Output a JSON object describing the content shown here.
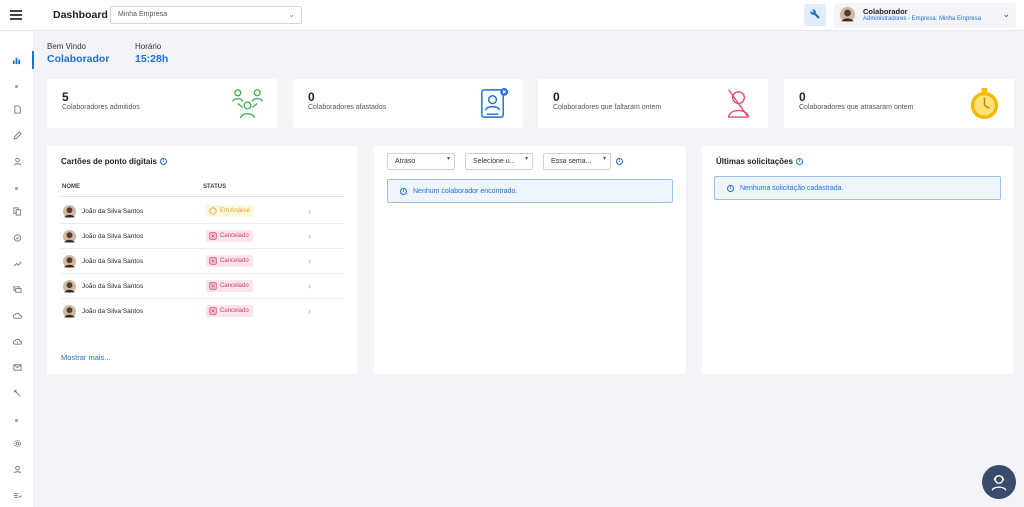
{
  "header": {
    "title": "Dashboard",
    "company": "Minha Empresa",
    "user_name": "Colaborador",
    "user_role": "Administradores - Empresa: Minha Empresa"
  },
  "sidebar": {
    "icons": [
      "chart-bar-icon",
      "file-icon",
      "pencil-icon",
      "user-icon",
      "copy-icon",
      "clock-check-icon",
      "trend-icon",
      "chat-icon",
      "cloud-upload-icon",
      "cloud-download-icon",
      "mail-icon",
      "wrench-icon",
      "gear-icon",
      "user-alt-icon",
      "list-icon"
    ]
  },
  "welcome": {
    "greeting_label": "Bem Vindo",
    "greeting_value": "Colaborador",
    "time_label": "Horário",
    "time_value": "15:28h"
  },
  "stats": [
    {
      "value": "5",
      "label": "Colaboradores admitidos",
      "icon": "people-network-icon",
      "color": "#2fb34a"
    },
    {
      "value": "0",
      "label": "Colaboradores afastados",
      "icon": "id-card-icon",
      "color": "#1e6fd9"
    },
    {
      "value": "0",
      "label": "Colaboradores que faltaram ontem",
      "icon": "absent-user-icon",
      "color": "#e84a6a"
    },
    {
      "value": "0",
      "label": "Colaboradores que atrasaram ontem",
      "icon": "stopwatch-icon",
      "color": "#f5b800"
    }
  ],
  "timecards": {
    "title": "Cartões de ponto digitais",
    "col_name": "NOME",
    "col_status": "STATUS",
    "rows": [
      {
        "name": "João da Silva Santos",
        "status": "Em Análise",
        "kind": "analise"
      },
      {
        "name": "João da Silva Santos",
        "status": "Cancelado",
        "kind": "cancel"
      },
      {
        "name": "João da Silva Santos",
        "status": "Cancelado",
        "kind": "cancel"
      },
      {
        "name": "João da Silva Santos",
        "status": "Cancelado",
        "kind": "cancel"
      },
      {
        "name": "João da Silva Santos",
        "status": "Cancelado",
        "kind": "cancel"
      }
    ],
    "more": "Mostrar mais..."
  },
  "filters": {
    "type": "Atraso",
    "select": "Selecione u...",
    "period": "Essa sema...",
    "empty": "Nenhum colaborador encontrado."
  },
  "requests": {
    "title": "Últimas solicitações",
    "empty": "Nenhuma solicitação cadastrada."
  }
}
